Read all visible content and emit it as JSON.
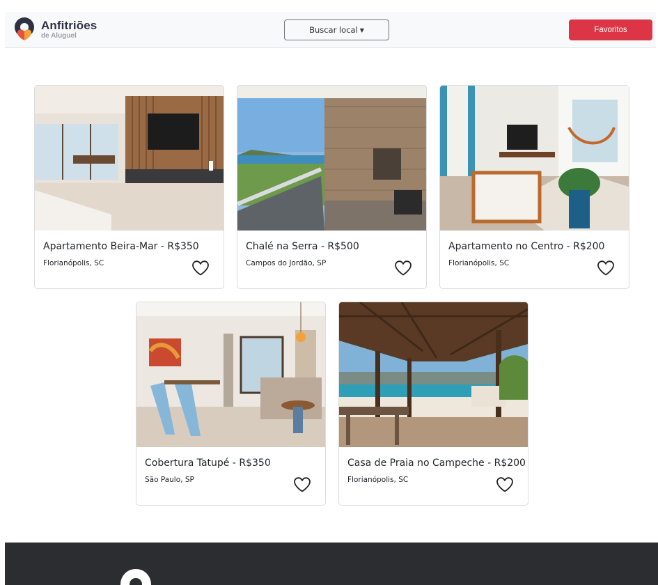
{
  "brand": {
    "name": "Anfitriões",
    "subtitle": "de Aluguel"
  },
  "navbar": {
    "search_label": "Buscar local",
    "favorites_label": "Favoritos"
  },
  "listings": [
    {
      "title": "Apartamento Beira-Mar - R$350",
      "location": "Florianópolis, SC"
    },
    {
      "title": "Chalé na Serra - R$500",
      "location": "Campos do Jordão, SP"
    },
    {
      "title": "Apartamento no Centro - R$200",
      "location": "Florianópolis, SC"
    },
    {
      "title": "Cobertura Tatupé - R$350",
      "location": "São Paulo, SP"
    },
    {
      "title": "Casa de Praia no Campeche - R$200",
      "location": "Florianópolis, SC"
    }
  ],
  "colors": {
    "favorites": "#dc3545",
    "footer": "#2b2d31",
    "navbar": "#f8f9fa"
  }
}
